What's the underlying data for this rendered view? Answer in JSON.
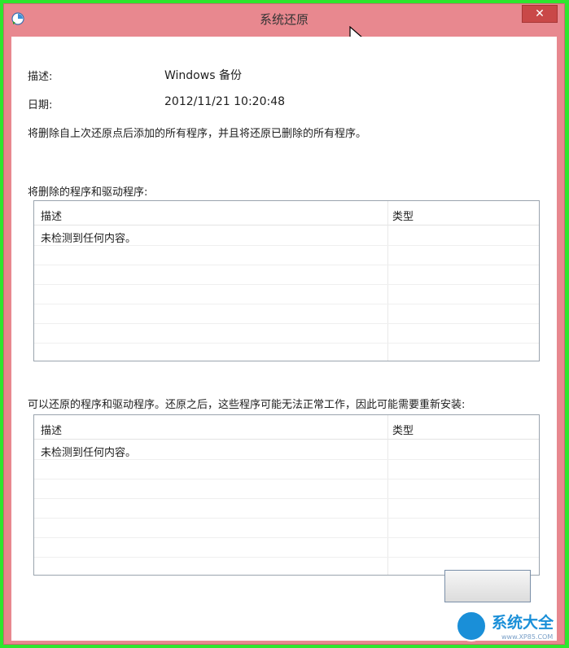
{
  "window": {
    "title": "系统还原",
    "close_label": "✕",
    "icon": "system-restore-icon"
  },
  "details": {
    "description_label": "描述:",
    "description_value": "Windows 备份",
    "date_label": "日期:",
    "date_value": "2012/11/21 10:20:48",
    "summary": "将删除自上次还原点后添加的所有程序，并且将还原已删除的所有程序。"
  },
  "delete_section": {
    "label": "将删除的程序和驱动程序:",
    "columns": [
      "描述",
      "类型"
    ],
    "rows": [
      "未检测到任何内容。"
    ]
  },
  "restore_section": {
    "label": "可以还原的程序和驱动程序。还原之后，这些程序可能无法正常工作，因此可能需要重新安装:",
    "columns": [
      "描述",
      "类型"
    ],
    "rows": [
      "未检测到任何内容。"
    ]
  },
  "watermark": {
    "text": "系统大全",
    "sub": "www.XP85.COM"
  },
  "colors": {
    "titlebar": "#e8888f",
    "close_button": "#c94848",
    "frame": "#2ee62e",
    "watermark": "#1a8fd8"
  }
}
